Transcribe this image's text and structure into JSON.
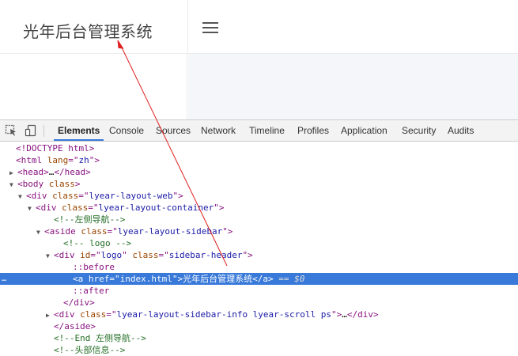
{
  "webpage": {
    "logo_text": "光年后台管理系统"
  },
  "devtools": {
    "tabs": [
      "Elements",
      "Console",
      "Sources",
      "Network",
      "Timeline",
      "Profiles",
      "Application",
      "Security",
      "Audits"
    ],
    "active_tab": "Elements",
    "dom_lines": [
      {
        "tri": "",
        "parts": [
          [
            "tag",
            "<!DOCTYPE html>"
          ]
        ]
      },
      {
        "tri": "",
        "parts": [
          [
            "tag",
            "<html "
          ],
          [
            "an",
            "lang"
          ],
          [
            "tag",
            "=\""
          ],
          [
            "av",
            "zh"
          ],
          [
            "tag",
            "\">"
          ]
        ]
      },
      {
        "tri": "▶",
        "parts": [
          [
            "tag",
            "<head>"
          ],
          [
            "txt",
            "…"
          ],
          [
            "tag",
            "</head>"
          ]
        ]
      },
      {
        "tri": "▼",
        "parts": [
          [
            "tag",
            "<body "
          ],
          [
            "an",
            "class"
          ],
          [
            "tag",
            ">"
          ]
        ]
      },
      {
        "tri": "▼",
        "parts": [
          [
            "tag",
            "<div "
          ],
          [
            "an",
            "class"
          ],
          [
            "tag",
            "=\""
          ],
          [
            "av",
            "lyear-layout-web"
          ],
          [
            "tag",
            "\">"
          ]
        ]
      },
      {
        "tri": "▼",
        "parts": [
          [
            "tag",
            "<div "
          ],
          [
            "an",
            "class"
          ],
          [
            "tag",
            "=\""
          ],
          [
            "av",
            "lyear-layout-container"
          ],
          [
            "tag",
            "\">"
          ]
        ]
      },
      {
        "tri": "",
        "parts": [
          [
            "cm",
            "<!--左侧导航-->"
          ]
        ]
      },
      {
        "tri": "▼",
        "parts": [
          [
            "tag",
            "<aside "
          ],
          [
            "an",
            "class"
          ],
          [
            "tag",
            "=\""
          ],
          [
            "av",
            "lyear-layout-sidebar"
          ],
          [
            "tag",
            "\">"
          ]
        ]
      },
      {
        "tri": "",
        "parts": [
          [
            "cm",
            "<!-- logo -->"
          ]
        ]
      },
      {
        "tri": "▼",
        "parts": [
          [
            "tag",
            "<div "
          ],
          [
            "an",
            "id"
          ],
          [
            "tag",
            "=\""
          ],
          [
            "av",
            "logo"
          ],
          [
            "tag",
            "\" "
          ],
          [
            "an",
            "class"
          ],
          [
            "tag",
            "=\""
          ],
          [
            "av",
            "sidebar-header"
          ],
          [
            "tag",
            "\">"
          ]
        ]
      },
      {
        "tri": "",
        "parts": [
          [
            "pseudo",
            "::before"
          ]
        ]
      },
      {
        "tri": "",
        "parts": [
          [
            "tag",
            "<a "
          ],
          [
            "an",
            "href"
          ],
          [
            "tag",
            "=\""
          ],
          [
            "av",
            "index.html"
          ],
          [
            "tag",
            "\">"
          ],
          [
            "txt",
            "光年后台管理系统"
          ],
          [
            "tag",
            "</a>"
          ],
          [
            "eq",
            " == $0"
          ]
        ]
      },
      {
        "tri": "",
        "parts": [
          [
            "pseudo",
            "::after"
          ]
        ]
      },
      {
        "tri": "",
        "parts": [
          [
            "tag",
            "</div>"
          ]
        ]
      },
      {
        "tri": "▶",
        "parts": [
          [
            "tag",
            "<div "
          ],
          [
            "an",
            "class"
          ],
          [
            "tag",
            "=\""
          ],
          [
            "av",
            "lyear-layout-sidebar-info lyear-scroll ps"
          ],
          [
            "tag",
            "\">"
          ],
          [
            "txt",
            "…"
          ],
          [
            "tag",
            "</div>"
          ]
        ]
      },
      {
        "tri": "",
        "parts": [
          [
            "tag",
            "</aside>"
          ]
        ]
      },
      {
        "tri": "",
        "parts": [
          [
            "cm",
            "<!--End 左侧导航-->"
          ]
        ]
      },
      {
        "tri": "",
        "parts": [
          [
            "cm",
            "<!--头部信息-->"
          ]
        ]
      }
    ],
    "selected_dots": "…"
  },
  "colors": {
    "accent": "#3879d9",
    "arrow": "#e02020"
  },
  "icons": [
    "inspect-element-icon",
    "device-toolbar-icon",
    "menu-toggle-icon"
  ]
}
